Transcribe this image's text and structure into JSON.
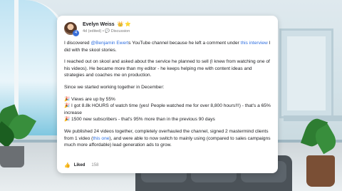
{
  "post": {
    "author": "Evelyn Weiss",
    "author_badges": "👑 ⭐",
    "level": "4",
    "edited": "4d (edited)",
    "separator": "•",
    "category_icon": "💬",
    "category": "Discussion",
    "p1": {
      "before": "I discovered ",
      "link1": "@Benjamin Ewert",
      "middle": "s YouTube channel because he left a comment under ",
      "link2": "this interview",
      "after": " I did with the skool stories."
    },
    "p2": "I reached out on skool and asked about the service he planned to sell (I knew from watching one of his videos). He became more than my editor - he keeps helping me with content ideas and strategies and coaches me on production.",
    "p3": "Since we started working together in December:",
    "bullets": [
      "🎉 Views are up by 55%",
      "🎉 I got 8.8k HOURS of watch time (yes! People watched me for over 8,800 hours!!!) - that's a 65% increase",
      "🎉 1500 new subscribers - that's 95% more than in the previous 90 days"
    ],
    "p5": {
      "before": "We published 24 videos together, completely overhauled the channel, signed 2 mastermind clients from 1 video (",
      "link": "this one",
      "after": "), and were able to now switch to mainly using (compared to sales campaigns much more affordable) lead generation ads to grow."
    },
    "like_icon": "👍",
    "like_label": "Liked",
    "like_count": "158"
  }
}
